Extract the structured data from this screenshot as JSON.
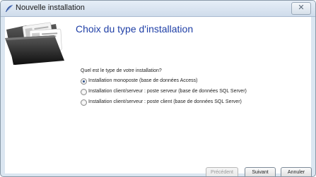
{
  "window": {
    "title": "Nouvelle installation",
    "close_glyph": "✕"
  },
  "page": {
    "heading": "Choix du type d'installation",
    "question": "Quel est le type de votre installation?",
    "options": [
      {
        "label": "Installation monoposte (base de données Access)",
        "selected": true
      },
      {
        "label": "Installation client/serveur : poste serveur (base de données SQL Server)",
        "selected": false
      },
      {
        "label": "Installation client/serveur : poste client (base de données SQL Server)",
        "selected": false
      }
    ]
  },
  "buttons": {
    "previous": "Précédent",
    "next": "Suivant",
    "cancel": "Annuler"
  },
  "icons": {
    "app": "feather-icon",
    "close": "close-icon",
    "header": "documents-folder-icon"
  },
  "colors": {
    "heading": "#1f3fa6",
    "titlebar": "#dbe6f1"
  }
}
